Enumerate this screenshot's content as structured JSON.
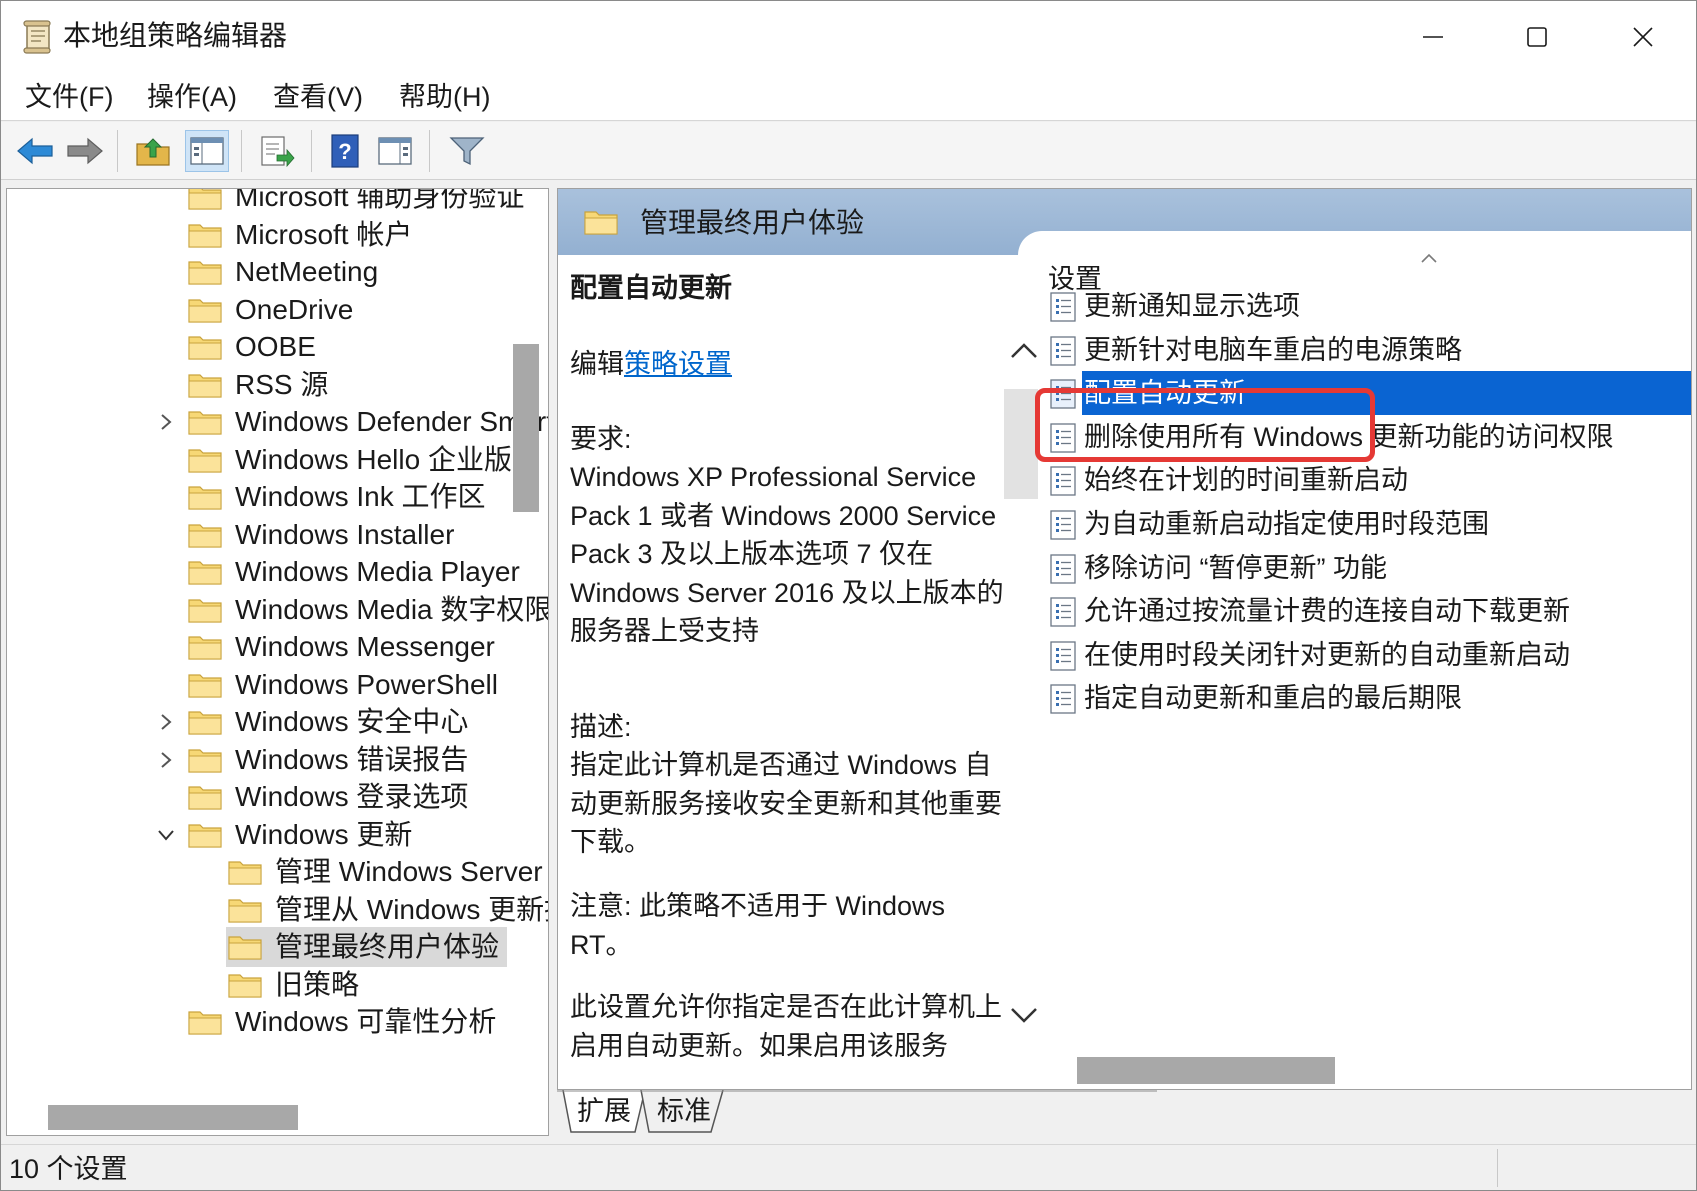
{
  "window": {
    "title": "本地组策略编辑器"
  },
  "menu": [
    "文件(F)",
    "操作(A)",
    "查看(V)",
    "帮助(H)"
  ],
  "tree": {
    "items": [
      {
        "label": "Microsoft 辅助身份验证",
        "expandable": false,
        "indent": 0
      },
      {
        "label": "Microsoft 帐户",
        "expandable": false,
        "indent": 0
      },
      {
        "label": "NetMeeting",
        "expandable": false,
        "indent": 0
      },
      {
        "label": "OneDrive",
        "expandable": false,
        "indent": 0
      },
      {
        "label": "OOBE",
        "expandable": false,
        "indent": 0
      },
      {
        "label": "RSS 源",
        "expandable": false,
        "indent": 0
      },
      {
        "label": "Windows Defender SmartScreen",
        "expandable": true,
        "indent": 0
      },
      {
        "label": "Windows Hello 企业版",
        "expandable": false,
        "indent": 0
      },
      {
        "label": "Windows Ink 工作区",
        "expandable": false,
        "indent": 0
      },
      {
        "label": "Windows Installer",
        "expandable": false,
        "indent": 0
      },
      {
        "label": "Windows Media Player",
        "expandable": false,
        "indent": 0
      },
      {
        "label": "Windows Media 数字权限管理",
        "expandable": false,
        "indent": 0
      },
      {
        "label": "Windows Messenger",
        "expandable": false,
        "indent": 0
      },
      {
        "label": "Windows PowerShell",
        "expandable": false,
        "indent": 0
      },
      {
        "label": "Windows 安全中心",
        "expandable": true,
        "indent": 0
      },
      {
        "label": "Windows 错误报告",
        "expandable": true,
        "indent": 0
      },
      {
        "label": "Windows 登录选项",
        "expandable": false,
        "indent": 0
      },
      {
        "label": "Windows 更新",
        "expandable": true,
        "expanded": true,
        "indent": 0
      },
      {
        "label": "管理 Windows Server Update Service 提供的更新",
        "expandable": false,
        "indent": 1
      },
      {
        "label": "管理从 Windows 更新提供的更新",
        "expandable": false,
        "indent": 1
      },
      {
        "label": "管理最终用户体验",
        "expandable": false,
        "indent": 1,
        "selected": true
      },
      {
        "label": "旧策略",
        "expandable": false,
        "indent": 1
      },
      {
        "label": "Windows 可靠性分析",
        "expandable": false,
        "indent": 0
      }
    ]
  },
  "detail": {
    "header": "管理最终用户体验",
    "heading": "配置自动更新",
    "edit_prefix": "编辑",
    "edit_link": "策略设置",
    "requirements_label": "要求:",
    "requirements": "Windows XP Professional Service Pack 1 或者 Windows 2000 Service Pack 3 及以上版本选项 7 仅在 Windows Server 2016 及以上版本的服务器上受支持",
    "description_label": "描述:",
    "description": "指定此计算机是否通过 Windows 自动更新服务接收安全更新和其他重要下载。",
    "note": "注意: 此策略不适用于 Windows RT。",
    "more": "此设置允许你指定是否在此计算机上启用自动更新。如果启用该服务"
  },
  "settings": {
    "column_header": "设置",
    "items": [
      {
        "label": "更新通知显示选项"
      },
      {
        "label": "更新针对电脑车重启的电源策略"
      },
      {
        "label": "配置自动更新",
        "selected": true
      },
      {
        "label": "删除使用所有 Windows 更新功能的访问权限"
      },
      {
        "label": "始终在计划的时间重新启动"
      },
      {
        "label": "为自动重新启动指定使用时段范围"
      },
      {
        "label": "移除访问 “暂停更新” 功能"
      },
      {
        "label": "允许通过按流量计费的连接自动下载更新"
      },
      {
        "label": "在使用时段关闭针对更新的自动重新启动"
      },
      {
        "label": "指定自动更新和重启的最后期限"
      }
    ]
  },
  "tabs": [
    "扩展",
    "标准"
  ],
  "status": {
    "text": "10 个设置"
  },
  "colors": {
    "selection": "#0a64d2",
    "highlight_border": "#e53935",
    "header_blue": "#a9c1dc",
    "link": "#0066cc"
  }
}
